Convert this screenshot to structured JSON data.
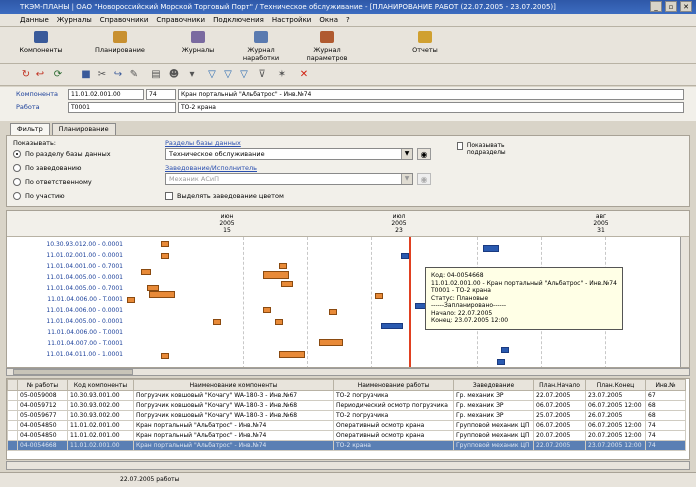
{
  "window": {
    "title": "ТКЭМ-ПЛАНЫ | ОАО \"Новороссийский Морской Торговый Порт\" / Техническое обслуживание - [ПЛАНИРОВАНИЕ РАБОТ (22.07.2005 - 23.07.2005)]",
    "controls": [
      "_",
      "▫",
      "✕"
    ]
  },
  "menu": [
    "Данные",
    "Журналы",
    "Справочники",
    "Справочники",
    "Подключения",
    "Настройки",
    "Окна",
    "?"
  ],
  "big_toolbar": [
    {
      "label": "Компоненты",
      "color": "#3a5a9a"
    },
    {
      "label": "Планирование",
      "color": "#c89030"
    },
    {
      "label": "Журналы",
      "color": "#7a6aa0"
    },
    {
      "label": "Журнал наработки",
      "color": "#5a7ab0"
    },
    {
      "label": "Журнал параметров",
      "color": "#b05a30"
    },
    {
      "label": "Отчеты",
      "color": "#d0a030"
    }
  ],
  "small_toolbar_icons": [
    "refresh-icon",
    "back-icon",
    "sync-icon",
    "save-icon",
    "cut-icon",
    "redo-icon",
    "edit-icon",
    "print-icon",
    "user-icon",
    "filter-icon",
    "filter-add-icon",
    "filter-remove-icon",
    "filter-clear-icon",
    "funnel-icon",
    "star-icon",
    "delete-icon"
  ],
  "info": {
    "component_label": "Компонента",
    "component_code": "11.01.02.001.00",
    "component_num": "74",
    "component_name": "Кран портальный \"Альбатрос\" - Инв.№74",
    "work_label": "Работа",
    "work_code": "T0001",
    "work_name": "ТО-2 крана"
  },
  "tabs": [
    "Фильтр",
    "Планирование"
  ],
  "filter": {
    "show_label": "Показывать:",
    "radios": [
      {
        "label": "По разделу базы данных",
        "checked": true
      },
      {
        "label": "По заведованию",
        "checked": false
      },
      {
        "label": "По ответственному",
        "checked": false
      },
      {
        "label": "По участию",
        "checked": false
      }
    ],
    "section_label": "Разделы базы данных",
    "section_value": "Техническое обслуживание",
    "executor_label": "Заведование/Исполнитель",
    "executor_value": "Механик АСиП",
    "highlight_label": "Выделять заведование цветом",
    "show_subsections_label": "Показывать подразделы"
  },
  "gantt": {
    "months": [
      {
        "name": "июн",
        "year": "2005",
        "week": "15"
      },
      {
        "name": "июл",
        "year": "2005",
        "week": "23"
      },
      {
        "name": "авг",
        "year": "2005",
        "week": "31"
      }
    ],
    "rows": [
      "10.30.93.012.00 - 0.0001",
      "11.01.02.001.00 - 0.0001",
      "11.01.04.001.00 - 0.7001",
      "11.01.04.005.00 - 0.0001",
      "11.01.04.005.00 - 0.7001",
      "11.01.04.006.00 - T.0001",
      "11.01.04.006.00 - 0.0001",
      "11.01.04.005.00 - 0.0001",
      "11.01.04.006.00 - T.0001",
      "11.01.04.007.00 - T.0001",
      "11.01.04.011.00 - 1.0001"
    ],
    "tooltip": [
      "Код: 04-0054668",
      "11.01.02.001.00 - Кран портальный \"Альбатрос\" - Инв.№74",
      "T0001 - ТО-2 крана",
      "Статус: Плановые",
      "------Запланировано------",
      "Начало: 22.07.2005",
      "Конец: 23.07.2005 12:00"
    ]
  },
  "table": {
    "columns": [
      "№ работы",
      "Код компоненты",
      "Наименование компоненты",
      "Наименование работы",
      "Заведование",
      "План.Начало",
      "План.Конец",
      "Инв.№"
    ],
    "rows": [
      [
        "05-0059008",
        "10.30.93.001.00",
        "Погрузчик ковшовый \"Кочагу\" WA-180-3 - Инв.№67",
        "ТО-2 погрузчика",
        "Гр. механик ЗР",
        "22.07.2005",
        "23.07.2005",
        "67"
      ],
      [
        "04-0059712",
        "10.30.93.002.00",
        "Погрузчик ковшовый \"Кочагу\" WA-180-3 - Инв.№68",
        "Периодический осмотр погрузчика",
        "Гр. механик ЗР",
        "06.07.2005",
        "06.07.2005 12:00",
        "68"
      ],
      [
        "05-0059677",
        "10.30.93.002.00",
        "Погрузчик ковшовый \"Кочагу\" WA-180-3 - Инв.№68",
        "ТО-2 погрузчика",
        "Гр. механик ЗР",
        "25.07.2005",
        "26.07.2005",
        "68"
      ],
      [
        "04-0054850",
        "11.01.02.001.00",
        "Кран портальный \"Альбатрос\" - Инв.№74",
        "Оперативный осмотр крана",
        "Групповой механик ЦП",
        "06.07.2005",
        "06.07.2005 12:00",
        "74"
      ],
      [
        "04-0054850",
        "11.01.02.001.00",
        "Кран портальный \"Альбатрос\" - Инв.№74",
        "Оперативный осмотр крана",
        "Групповой механик ЦП",
        "20.07.2005",
        "20.07.2005 12:00",
        "74"
      ],
      [
        "04-0054668",
        "11.01.02.001.00",
        "Кран портальный \"Альбатрос\" - Инв.№74",
        "ТО-2 крана",
        "Групповой механик ЦП",
        "22.07.2005",
        "23.07.2005 12:00",
        "74"
      ]
    ]
  },
  "status": "22.07.2005 работы"
}
